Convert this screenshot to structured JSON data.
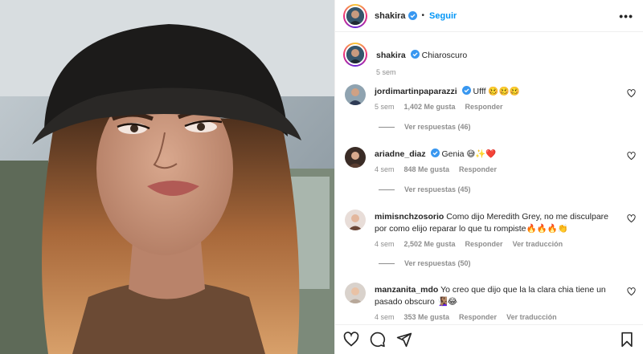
{
  "header": {
    "username": "shakira",
    "separator": "•",
    "follow_label": "Seguir",
    "more_label": "•••"
  },
  "caption": {
    "username": "shakira",
    "text": "Chiaroscuro",
    "time": "5 sem"
  },
  "comments": [
    {
      "username": "jordimartinpaparazzi",
      "verified": true,
      "text": "Ufff 🥴🥴🥴",
      "time": "5 sem",
      "likes": "1,402 Me gusta",
      "reply_label": "Responder",
      "translate_label": "",
      "replies": "Ver respuestas (46)"
    },
    {
      "username": "ariadne_diaz",
      "verified": true,
      "text": "Genia 😅✨❤️",
      "time": "4 sem",
      "likes": "848 Me gusta",
      "reply_label": "Responder",
      "translate_label": "",
      "replies": "Ver respuestas (45)"
    },
    {
      "username": "mimisnchzosorio",
      "verified": false,
      "text": "Como dijo Meredith Grey, no me disculpare por como elijo reparar lo que tu rompiste🔥🔥🔥👏",
      "time": "4 sem",
      "likes": "2,502 Me gusta",
      "reply_label": "Responder",
      "translate_label": "Ver traducción",
      "replies": "Ver respuestas (50)"
    },
    {
      "username": "manzanita_mdo",
      "verified": false,
      "text": "Yo creo que dijo que la la clara chia tiene un pasado obscuro 🧏🏽‍♀️😂",
      "time": "4 sem",
      "likes": "353 Me gusta",
      "reply_label": "Responder",
      "translate_label": "Ver traducción",
      "replies": ""
    }
  ],
  "icons": {
    "like": "heart-icon",
    "comment": "comment-icon",
    "share": "share-icon",
    "save": "bookmark-icon",
    "verified": "verified-badge-icon"
  },
  "colors": {
    "accent": "#0095f6",
    "verified": "#3897f0",
    "muted": "#8e8e8e",
    "text": "#262626"
  }
}
